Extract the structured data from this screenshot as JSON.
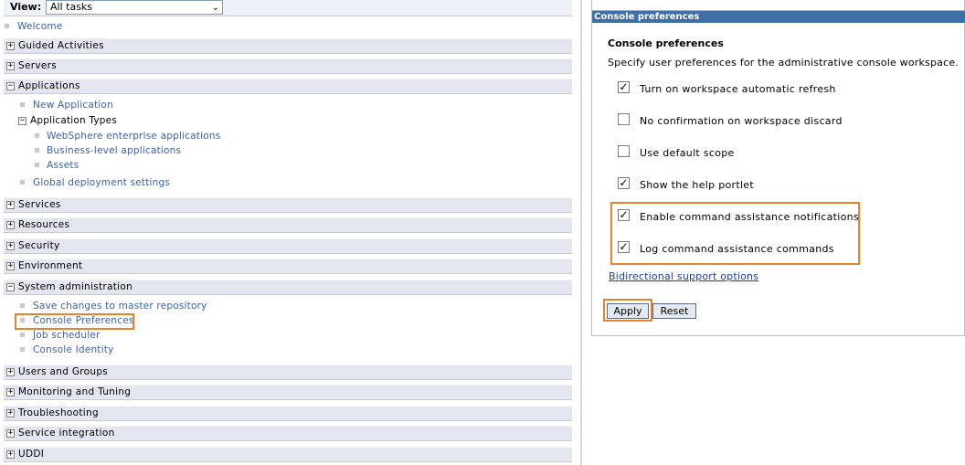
{
  "view": {
    "label": "View:",
    "selected": "All tasks"
  },
  "nav": {
    "welcome": "Welcome",
    "guided_activities": "Guided Activities",
    "servers": "Servers",
    "applications": "Applications",
    "new_application": "New Application",
    "application_types": "Application Types",
    "websphere_apps": "WebSphere enterprise applications",
    "business_level_apps": "Business-level applications",
    "assets": "Assets",
    "global_deployment": "Global deployment settings",
    "services": "Services",
    "resources": "Resources",
    "security": "Security",
    "environment": "Environment",
    "system_administration": "System administration",
    "save_changes": "Save changes to master repository",
    "console_preferences": "Console Preferences",
    "job_scheduler": "Job scheduler",
    "console_identity": "Console Identity",
    "users_and_groups": "Users and Groups",
    "monitoring_and_tuning": "Monitoring and Tuning",
    "troubleshooting": "Troubleshooting",
    "service_integration": "Service integration",
    "uddi": "UDDI"
  },
  "panel": {
    "title": "Console preferences",
    "heading": "Console preferences",
    "description": "Specify user preferences for the administrative console workspace.",
    "options": [
      {
        "label": "Turn on workspace automatic refresh",
        "checked": true
      },
      {
        "label": "No confirmation on workspace discard",
        "checked": false
      },
      {
        "label": "Use default scope",
        "checked": false
      },
      {
        "label": "Show the help portlet",
        "checked": true
      },
      {
        "label": "Enable command assistance notifications",
        "checked": true
      },
      {
        "label": "Log command assistance commands",
        "checked": true
      }
    ],
    "bidi_link": "Bidirectional support options",
    "apply": "Apply",
    "reset": "Reset"
  },
  "colors": {
    "highlight": "#e8832a",
    "link": "#3a62a8",
    "title_bar": "#3e6fa7"
  }
}
